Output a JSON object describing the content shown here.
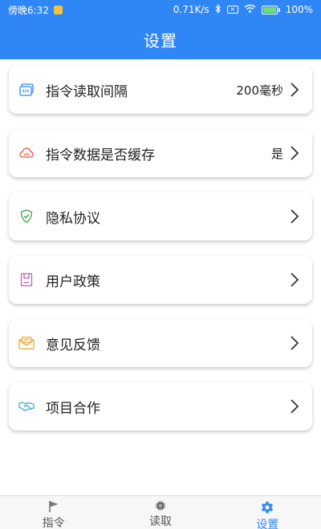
{
  "status_bar": {
    "time": "傍晚6:32",
    "network_speed": "0.71K/s",
    "battery_percent": "100%",
    "battery_level": 1.0
  },
  "header": {
    "title": "设置"
  },
  "settings": [
    {
      "label": "指令读取间隔",
      "value": "200毫秒",
      "icon": "code-window-icon",
      "color": "#2f87f6"
    },
    {
      "label": "指令数据是否缓存",
      "value": "是",
      "icon": "cloud-icon",
      "color": "#e05a4a"
    },
    {
      "label": "隐私协议",
      "value": "",
      "icon": "shield-check-icon",
      "color": "#3aa54a"
    },
    {
      "label": "用户政策",
      "value": "",
      "icon": "document-icon",
      "color": "#c060b8"
    },
    {
      "label": "意见反馈",
      "value": "",
      "icon": "envelope-icon",
      "color": "#f0a020"
    },
    {
      "label": "项目合作",
      "value": "",
      "icon": "handshake-icon",
      "color": "#2a9fd0"
    }
  ],
  "bottom_nav": [
    {
      "label": "指令",
      "icon": "flag-icon",
      "active": false
    },
    {
      "label": "读取",
      "icon": "chip-icon",
      "active": false
    },
    {
      "label": "设置",
      "icon": "gear-icon",
      "active": true
    }
  ],
  "colors": {
    "primary": "#2f87f6",
    "card_bg": "#ffffff",
    "nav_bg": "#f7f7f7"
  }
}
